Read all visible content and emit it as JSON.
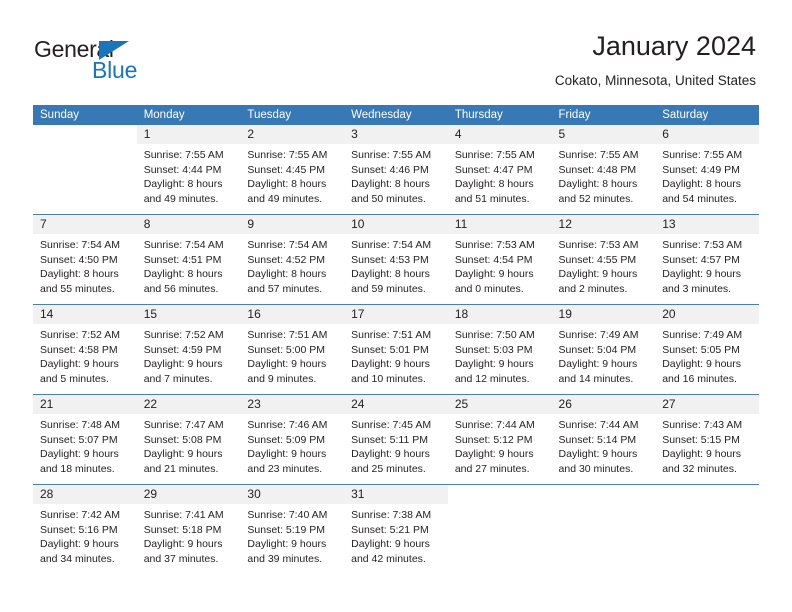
{
  "brand": {
    "name_part1": "General",
    "name_part2": "Blue",
    "accent_color": "#1b75bb",
    "triangle_icon": "triangle-icon"
  },
  "header": {
    "title": "January 2024",
    "subtitle": "Cokato, Minnesota, United States"
  },
  "calendar": {
    "header_bg": "#3878b4",
    "daynum_bg": "#f1f1f1",
    "weekday_headers": [
      "Sunday",
      "Monday",
      "Tuesday",
      "Wednesday",
      "Thursday",
      "Friday",
      "Saturday"
    ],
    "weeks": [
      [
        {
          "day": "",
          "sunrise": "",
          "sunset": "",
          "daylight1": "",
          "daylight2": ""
        },
        {
          "day": "1",
          "sunrise": "Sunrise: 7:55 AM",
          "sunset": "Sunset: 4:44 PM",
          "daylight1": "Daylight: 8 hours",
          "daylight2": "and 49 minutes."
        },
        {
          "day": "2",
          "sunrise": "Sunrise: 7:55 AM",
          "sunset": "Sunset: 4:45 PM",
          "daylight1": "Daylight: 8 hours",
          "daylight2": "and 49 minutes."
        },
        {
          "day": "3",
          "sunrise": "Sunrise: 7:55 AM",
          "sunset": "Sunset: 4:46 PM",
          "daylight1": "Daylight: 8 hours",
          "daylight2": "and 50 minutes."
        },
        {
          "day": "4",
          "sunrise": "Sunrise: 7:55 AM",
          "sunset": "Sunset: 4:47 PM",
          "daylight1": "Daylight: 8 hours",
          "daylight2": "and 51 minutes."
        },
        {
          "day": "5",
          "sunrise": "Sunrise: 7:55 AM",
          "sunset": "Sunset: 4:48 PM",
          "daylight1": "Daylight: 8 hours",
          "daylight2": "and 52 minutes."
        },
        {
          "day": "6",
          "sunrise": "Sunrise: 7:55 AM",
          "sunset": "Sunset: 4:49 PM",
          "daylight1": "Daylight: 8 hours",
          "daylight2": "and 54 minutes."
        }
      ],
      [
        {
          "day": "7",
          "sunrise": "Sunrise: 7:54 AM",
          "sunset": "Sunset: 4:50 PM",
          "daylight1": "Daylight: 8 hours",
          "daylight2": "and 55 minutes."
        },
        {
          "day": "8",
          "sunrise": "Sunrise: 7:54 AM",
          "sunset": "Sunset: 4:51 PM",
          "daylight1": "Daylight: 8 hours",
          "daylight2": "and 56 minutes."
        },
        {
          "day": "9",
          "sunrise": "Sunrise: 7:54 AM",
          "sunset": "Sunset: 4:52 PM",
          "daylight1": "Daylight: 8 hours",
          "daylight2": "and 57 minutes."
        },
        {
          "day": "10",
          "sunrise": "Sunrise: 7:54 AM",
          "sunset": "Sunset: 4:53 PM",
          "daylight1": "Daylight: 8 hours",
          "daylight2": "and 59 minutes."
        },
        {
          "day": "11",
          "sunrise": "Sunrise: 7:53 AM",
          "sunset": "Sunset: 4:54 PM",
          "daylight1": "Daylight: 9 hours",
          "daylight2": "and 0 minutes."
        },
        {
          "day": "12",
          "sunrise": "Sunrise: 7:53 AM",
          "sunset": "Sunset: 4:55 PM",
          "daylight1": "Daylight: 9 hours",
          "daylight2": "and 2 minutes."
        },
        {
          "day": "13",
          "sunrise": "Sunrise: 7:53 AM",
          "sunset": "Sunset: 4:57 PM",
          "daylight1": "Daylight: 9 hours",
          "daylight2": "and 3 minutes."
        }
      ],
      [
        {
          "day": "14",
          "sunrise": "Sunrise: 7:52 AM",
          "sunset": "Sunset: 4:58 PM",
          "daylight1": "Daylight: 9 hours",
          "daylight2": "and 5 minutes."
        },
        {
          "day": "15",
          "sunrise": "Sunrise: 7:52 AM",
          "sunset": "Sunset: 4:59 PM",
          "daylight1": "Daylight: 9 hours",
          "daylight2": "and 7 minutes."
        },
        {
          "day": "16",
          "sunrise": "Sunrise: 7:51 AM",
          "sunset": "Sunset: 5:00 PM",
          "daylight1": "Daylight: 9 hours",
          "daylight2": "and 9 minutes."
        },
        {
          "day": "17",
          "sunrise": "Sunrise: 7:51 AM",
          "sunset": "Sunset: 5:01 PM",
          "daylight1": "Daylight: 9 hours",
          "daylight2": "and 10 minutes."
        },
        {
          "day": "18",
          "sunrise": "Sunrise: 7:50 AM",
          "sunset": "Sunset: 5:03 PM",
          "daylight1": "Daylight: 9 hours",
          "daylight2": "and 12 minutes."
        },
        {
          "day": "19",
          "sunrise": "Sunrise: 7:49 AM",
          "sunset": "Sunset: 5:04 PM",
          "daylight1": "Daylight: 9 hours",
          "daylight2": "and 14 minutes."
        },
        {
          "day": "20",
          "sunrise": "Sunrise: 7:49 AM",
          "sunset": "Sunset: 5:05 PM",
          "daylight1": "Daylight: 9 hours",
          "daylight2": "and 16 minutes."
        }
      ],
      [
        {
          "day": "21",
          "sunrise": "Sunrise: 7:48 AM",
          "sunset": "Sunset: 5:07 PM",
          "daylight1": "Daylight: 9 hours",
          "daylight2": "and 18 minutes."
        },
        {
          "day": "22",
          "sunrise": "Sunrise: 7:47 AM",
          "sunset": "Sunset: 5:08 PM",
          "daylight1": "Daylight: 9 hours",
          "daylight2": "and 21 minutes."
        },
        {
          "day": "23",
          "sunrise": "Sunrise: 7:46 AM",
          "sunset": "Sunset: 5:09 PM",
          "daylight1": "Daylight: 9 hours",
          "daylight2": "and 23 minutes."
        },
        {
          "day": "24",
          "sunrise": "Sunrise: 7:45 AM",
          "sunset": "Sunset: 5:11 PM",
          "daylight1": "Daylight: 9 hours",
          "daylight2": "and 25 minutes."
        },
        {
          "day": "25",
          "sunrise": "Sunrise: 7:44 AM",
          "sunset": "Sunset: 5:12 PM",
          "daylight1": "Daylight: 9 hours",
          "daylight2": "and 27 minutes."
        },
        {
          "day": "26",
          "sunrise": "Sunrise: 7:44 AM",
          "sunset": "Sunset: 5:14 PM",
          "daylight1": "Daylight: 9 hours",
          "daylight2": "and 30 minutes."
        },
        {
          "day": "27",
          "sunrise": "Sunrise: 7:43 AM",
          "sunset": "Sunset: 5:15 PM",
          "daylight1": "Daylight: 9 hours",
          "daylight2": "and 32 minutes."
        }
      ],
      [
        {
          "day": "28",
          "sunrise": "Sunrise: 7:42 AM",
          "sunset": "Sunset: 5:16 PM",
          "daylight1": "Daylight: 9 hours",
          "daylight2": "and 34 minutes."
        },
        {
          "day": "29",
          "sunrise": "Sunrise: 7:41 AM",
          "sunset": "Sunset: 5:18 PM",
          "daylight1": "Daylight: 9 hours",
          "daylight2": "and 37 minutes."
        },
        {
          "day": "30",
          "sunrise": "Sunrise: 7:40 AM",
          "sunset": "Sunset: 5:19 PM",
          "daylight1": "Daylight: 9 hours",
          "daylight2": "and 39 minutes."
        },
        {
          "day": "31",
          "sunrise": "Sunrise: 7:38 AM",
          "sunset": "Sunset: 5:21 PM",
          "daylight1": "Daylight: 9 hours",
          "daylight2": "and 42 minutes."
        },
        {
          "day": "",
          "sunrise": "",
          "sunset": "",
          "daylight1": "",
          "daylight2": ""
        },
        {
          "day": "",
          "sunrise": "",
          "sunset": "",
          "daylight1": "",
          "daylight2": ""
        },
        {
          "day": "",
          "sunrise": "",
          "sunset": "",
          "daylight1": "",
          "daylight2": ""
        }
      ]
    ]
  }
}
